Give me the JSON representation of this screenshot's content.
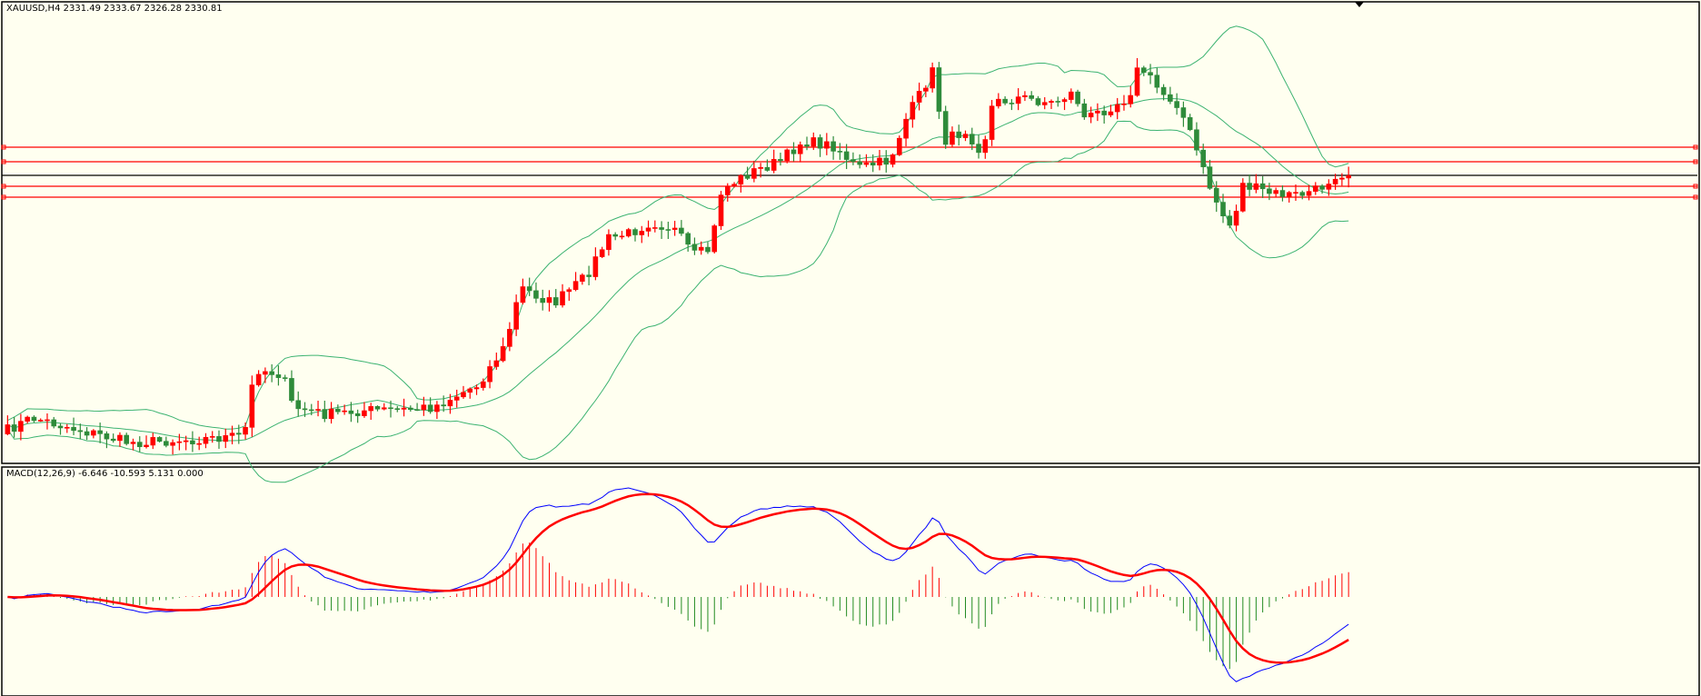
{
  "main_panel": {
    "symbol_label": "XAUUSD,H4  2331.49 2333.67 2326.28 2330.81",
    "symbol": "XAUUSD",
    "timeframe": "H4",
    "ohlc": {
      "open": "2331.49",
      "high": "2333.67",
      "low": "2326.28",
      "close": "2330.81"
    },
    "indicator": "Bollinger Bands",
    "horizontal_lines": [
      {
        "kind": "resistance",
        "color": "#ff0000"
      },
      {
        "kind": "resistance",
        "color": "#ff0000"
      },
      {
        "kind": "bid",
        "color": "#000000"
      },
      {
        "kind": "support",
        "color": "#ff0000"
      },
      {
        "kind": "support",
        "color": "#ff0000"
      }
    ]
  },
  "macd_panel": {
    "label": "MACD(12,26,9) -6.646 -10.593 5.131 0.000",
    "params": "12,26,9",
    "values": [
      "-6.646",
      "-10.593",
      "5.131",
      "0.000"
    ]
  },
  "colors": {
    "background": "#fffff0",
    "bull_candle": "#ff0000",
    "bear_candle": "#2e8b3a",
    "bands": "#3cb371",
    "macd_main": "#0000ff",
    "macd_signal": "#ff0000",
    "hist_positive": "#ff0000",
    "hist_negative": "#228b22"
  }
}
